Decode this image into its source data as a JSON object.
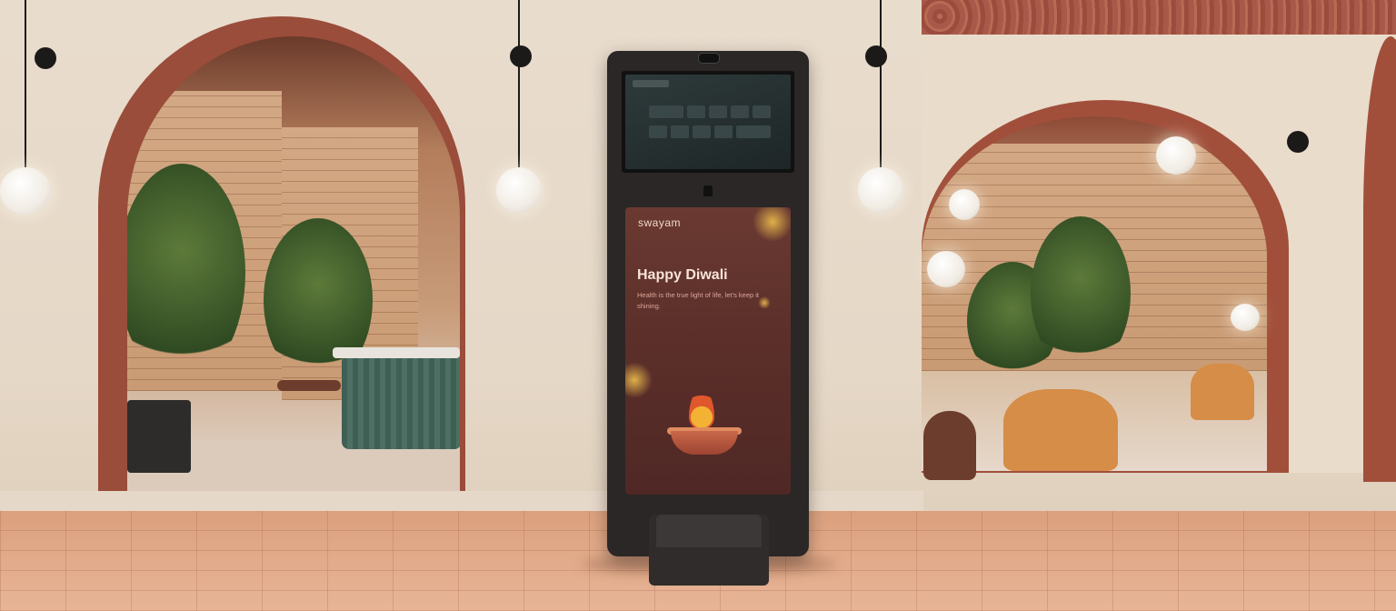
{
  "scene": {
    "description_tags": [
      "interior",
      "kiosk",
      "arches",
      "pendant-lamps",
      "plants"
    ]
  },
  "kiosk": {
    "poster": {
      "brand": "swayam",
      "headline": "Happy Diwali",
      "subtext": "Health is the true light of life, let's keep it shining."
    }
  },
  "colors": {
    "arch": "#9a4d3a",
    "kiosk_body": "#2a2726",
    "poster_bg": "#5c2f2a",
    "floor": "#e1a988"
  }
}
